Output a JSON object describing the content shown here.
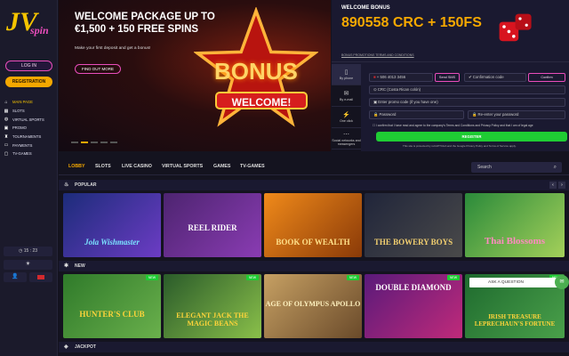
{
  "brand": {
    "logo_j": "JV",
    "logo_spin": "spin"
  },
  "sidebar": {
    "login": "LOG IN",
    "registration": "REGISTRATION",
    "items": [
      {
        "label": "MAIN PAGE",
        "icon": "home-icon",
        "active": true
      },
      {
        "label": "SLOTS",
        "icon": "slot-icon"
      },
      {
        "label": "VIRTUAL SPORTS",
        "icon": "ball-icon"
      },
      {
        "label": "PROMO",
        "icon": "gift-icon"
      },
      {
        "label": "TOURNAMENTS",
        "icon": "trophy-icon"
      },
      {
        "label": "PAYMENTS",
        "icon": "card-icon"
      },
      {
        "label": "TV-GAMES",
        "icon": "tv-icon"
      }
    ],
    "time": "15 : 23"
  },
  "hero": {
    "title": "WELCOME PACKAGE UP TO €1,500 + 150 FREE SPINS",
    "subtitle": "Make your first deposit and get a bonus!",
    "button": "FIND OUT MORE",
    "bonus_word": "BONUS",
    "welcome_word": "WELCOME!"
  },
  "welcome_bonus": {
    "label": "WELCOME BONUS",
    "amount": "890558 CRC + 150FS",
    "link": "BONUS PROMOTIONS TERMS AND CONDITIONS"
  },
  "registration": {
    "tabs": [
      "By phone",
      "By e-mail",
      "One click",
      "Social networks and messengers"
    ],
    "phone": "+ 506 4013 3456",
    "send_sms": "Send SMS",
    "confirmation_placeholder": "Confirmation code",
    "confirm": "Confirm",
    "currency": "CRC (Costa Rican colón)",
    "promo_placeholder": "Enter promo code (if you have one)",
    "password_placeholder": "Password",
    "repassword_placeholder": "Re-enter your password",
    "terms": "I confirm that I have read and agree to the company's Terms and Conditions and Privacy Policy and that I am of legal age",
    "register": "REGISTER",
    "recaptcha": "This site is protected by reCAPTCHA and the Google Privacy Policy and Terms of Service apply."
  },
  "categories": [
    "LOBBY",
    "SLOTS",
    "LIVE CASINO",
    "VIRTUAL SPORTS",
    "GAMES",
    "TV-GAMES"
  ],
  "search_placeholder": "Search",
  "sections": {
    "popular": "POPULAR",
    "new": "NEW",
    "jackpot": "JACKPOT"
  },
  "popular_games": [
    {
      "title": "Jola Wishmaster",
      "color": "#1c2c7a"
    },
    {
      "title": "REEL RIDER",
      "color": "#4d2470"
    },
    {
      "title": "BOOK OF WEALTH",
      "color": "#c75b10"
    },
    {
      "title": "THE BOWERY BOYS",
      "color": "#20253a"
    },
    {
      "title": "Thai Blossoms",
      "color": "#2a8a3a"
    }
  ],
  "new_games": [
    {
      "title": "HUNTER'S CLUB",
      "color": "#2f7a2a"
    },
    {
      "title": "ELEGANT JACK THE MAGIC BEANS",
      "color": "#2a5b2a"
    },
    {
      "title": "AGE OF OLYMPUS APOLLO",
      "color": "#c6a063"
    },
    {
      "title": "DOUBLE DIAMOND",
      "color": "#5a1a7a"
    },
    {
      "title": "IRISH TREASURE LEPRECHAUN'S FORTUNE",
      "color": "#1e6a2e"
    }
  ],
  "new_badge": "NEW",
  "ask_question": "ASK A QUESTION"
}
